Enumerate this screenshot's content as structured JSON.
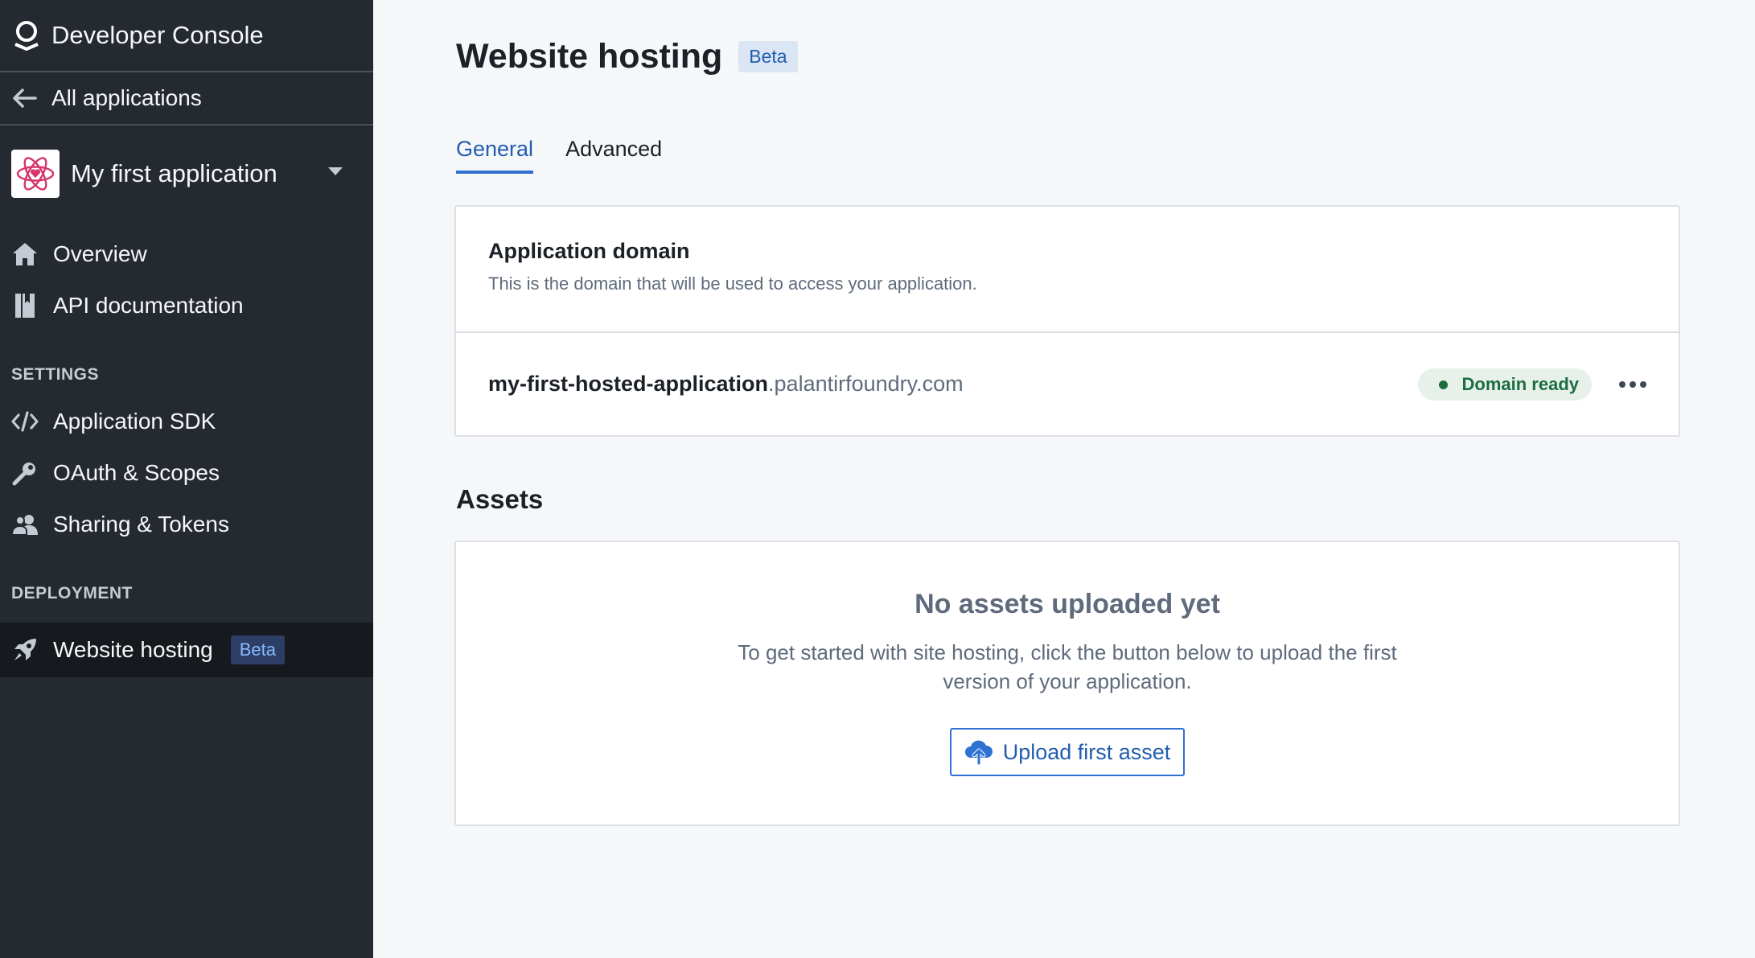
{
  "sidebar": {
    "header_title": "Developer Console",
    "back_label": "All applications",
    "app_name": "My first application",
    "nav": {
      "overview": "Overview",
      "api_docs": "API documentation"
    },
    "settings_label": "SETTINGS",
    "settings": {
      "sdk": "Application SDK",
      "oauth": "OAuth & Scopes",
      "sharing": "Sharing & Tokens"
    },
    "deployment_label": "DEPLOYMENT",
    "deployment": {
      "website_hosting": "Website hosting",
      "badge": "Beta"
    }
  },
  "page": {
    "title": "Website hosting",
    "badge": "Beta",
    "tabs": [
      "General",
      "Advanced"
    ],
    "active_tab": "General"
  },
  "domain_card": {
    "heading": "Application domain",
    "description": "This is the domain that will be used to access your application.",
    "subdomain": "my-first-hosted-application",
    "suffix": ".palantirfoundry.com",
    "status": "Domain ready"
  },
  "assets": {
    "heading": "Assets",
    "empty_title": "No assets uploaded yet",
    "empty_description": "To get started with site hosting, click the button below to upload the first version of your application.",
    "upload_button": "Upload first asset"
  },
  "colors": {
    "sidebar_bg": "#252a31",
    "accent": "#2d72d2",
    "status_green": "#1c6e42",
    "app_icon_pink": "#d6366b"
  },
  "icons": {
    "header": "palantir-logo-icon",
    "back": "arrow-left-icon",
    "app": "atom-heart-icon",
    "overview": "home-icon",
    "api_docs": "book-icon",
    "sdk": "code-icon",
    "oauth": "key-icon",
    "sharing": "people-icon",
    "website_hosting": "rocket-icon",
    "more": "more-horizontal-icon",
    "upload": "cloud-upload-icon"
  }
}
